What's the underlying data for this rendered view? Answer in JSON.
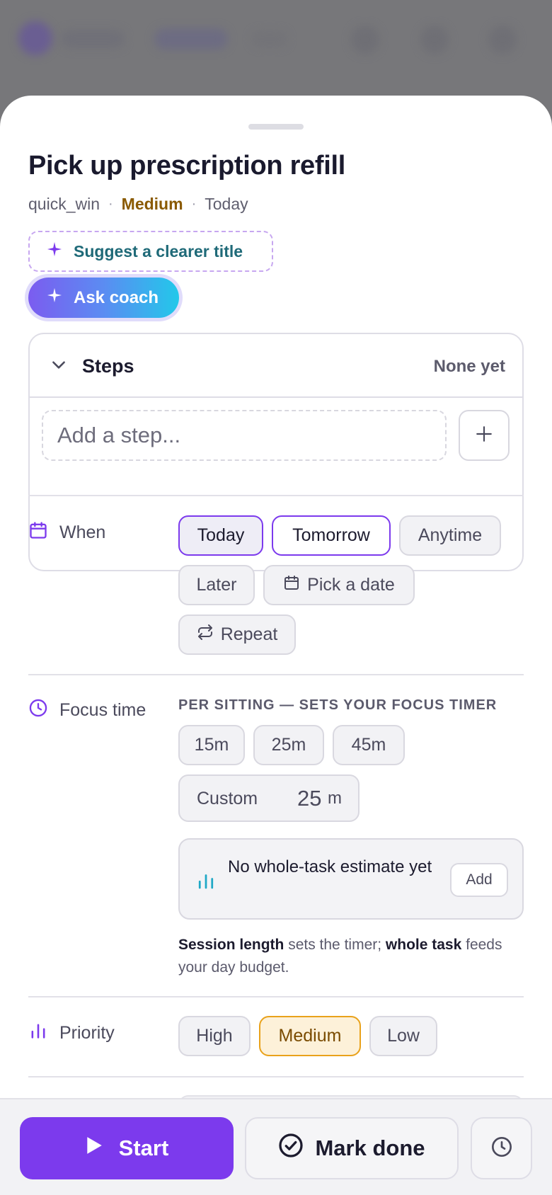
{
  "task": {
    "title": "Pick up prescription refill",
    "category": "quick_win",
    "priority": "Medium",
    "due": "Today"
  },
  "actions": {
    "suggest_title": "Suggest a clearer title",
    "ask_coach": "Ask coach"
  },
  "steps": {
    "label": "Steps",
    "status": "None yet",
    "input_placeholder": "Add a step..."
  },
  "when": {
    "label": "When",
    "options": [
      "Today",
      "Tomorrow",
      "Anytime",
      "Later",
      "Pick a date",
      "Repeat"
    ],
    "selected": "Today"
  },
  "focus": {
    "label": "Focus time",
    "caption": "PER SITTING — SETS YOUR FOCUS TIMER",
    "presets": [
      "15m",
      "25m",
      "45m"
    ],
    "custom_label": "Custom",
    "custom_value": "25",
    "custom_unit": "m",
    "estimate_text": "No whole-task estimate yet",
    "estimate_add": "Add",
    "note_bold_1": "Session length",
    "note_text_1": " sets the timer; ",
    "note_bold_2": "whole task",
    "note_text_2": " feeds your day budget."
  },
  "priority": {
    "label": "Priority",
    "options": [
      "High",
      "Medium",
      "Low"
    ],
    "selected": "Medium"
  },
  "bottom": {
    "start": "Start",
    "mark_done": "Mark done"
  },
  "colors": {
    "accent": "#7c3aed",
    "priority_medium": "#8a5a00",
    "coach_gradient_start": "#7b5cf0",
    "coach_gradient_end": "#22c8ea",
    "estimate_icon": "#1fa8c6"
  },
  "icons": {
    "suggest": "sparkle-icon",
    "coach": "sparkle-icon",
    "steps_toggle": "chevron-down-icon",
    "step_add": "plus-icon",
    "when": "calendar-icon",
    "pick_date": "calendar-icon",
    "repeat": "repeat-icon",
    "focus": "clock-icon",
    "estimate": "bar-chart-icon",
    "priority": "bar-chart-icon",
    "start": "play-icon",
    "mark_done": "check-circle-icon",
    "history": "clock-icon"
  }
}
